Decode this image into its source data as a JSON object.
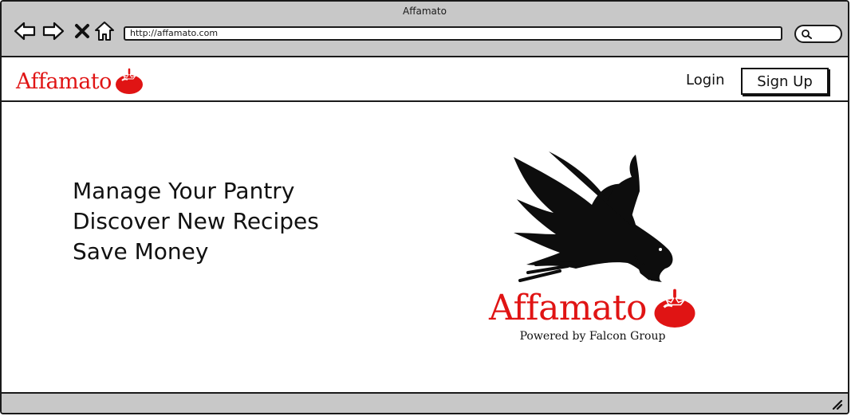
{
  "window": {
    "title": "Affamato"
  },
  "browser": {
    "url": "http://affamato.com",
    "icons": [
      "back-arrow-icon",
      "forward-arrow-icon",
      "close-x-icon",
      "home-icon",
      "search-icon"
    ]
  },
  "header": {
    "brand": "Affamato",
    "login_label": "Login",
    "signup_label": "Sign Up"
  },
  "main": {
    "taglines": [
      "Manage Your Pantry",
      "Discover New Recipes",
      "Save Money"
    ],
    "hero_brand": "Affamato",
    "hero_subtitle": "Powered by Falcon Group"
  },
  "colors": {
    "brand_red": "#e01414",
    "chrome_gray": "#c8c8c8",
    "ink": "#1a1a1a"
  }
}
